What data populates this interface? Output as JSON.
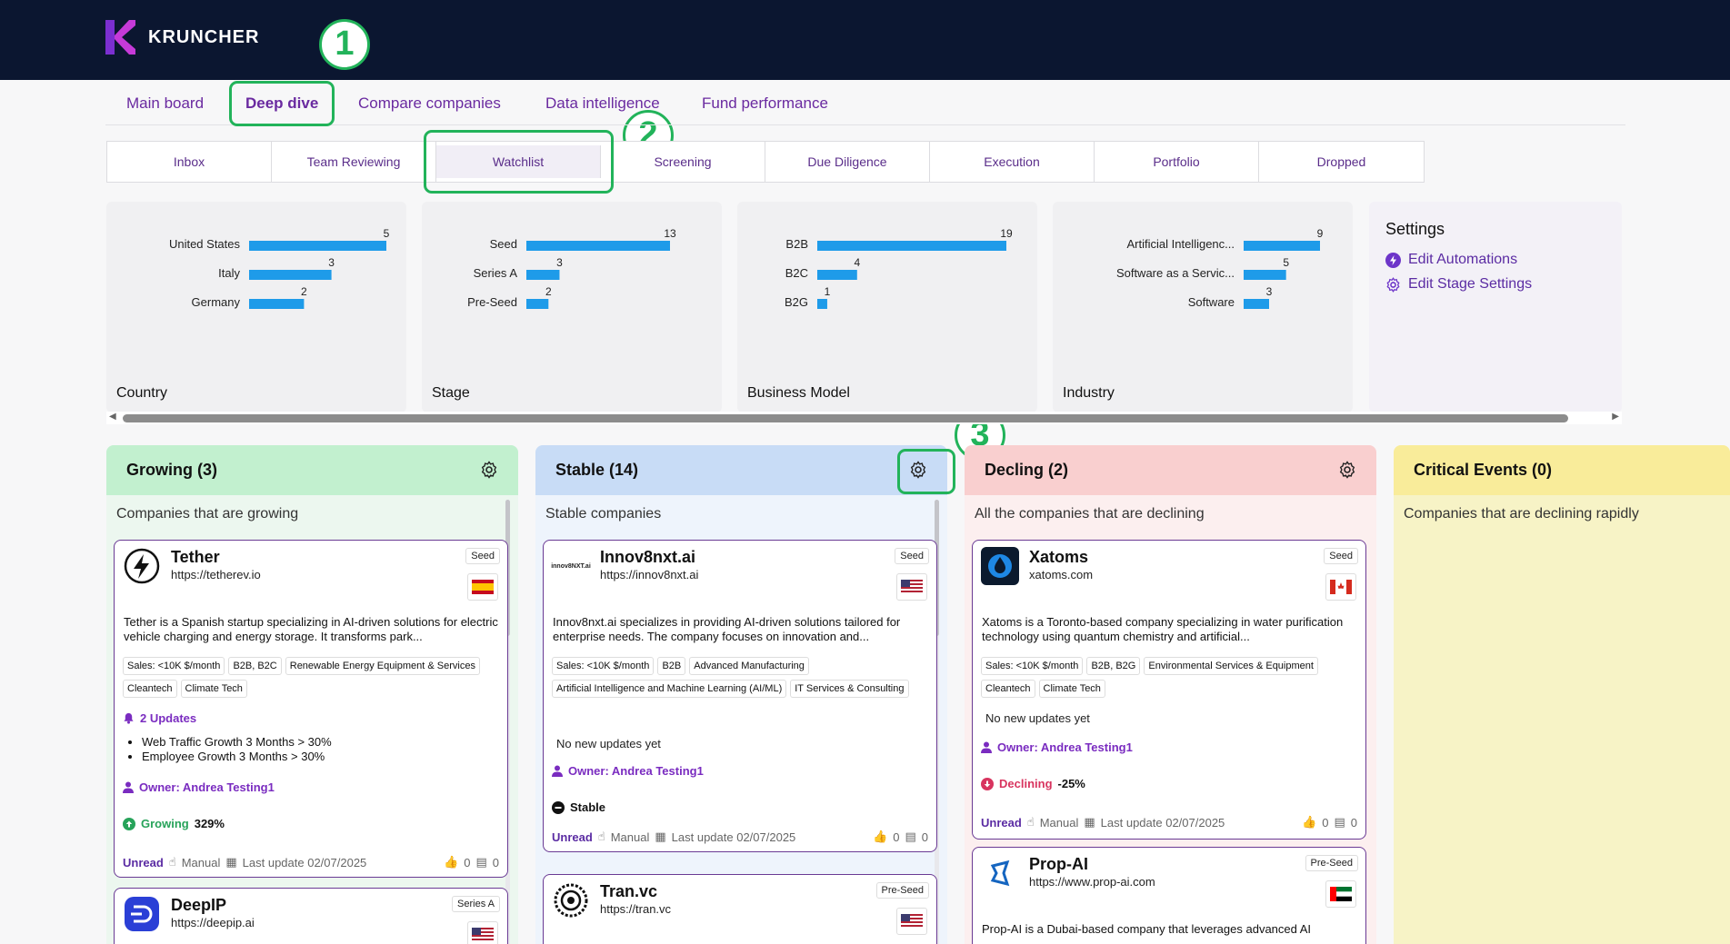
{
  "app": {
    "brand": "KRUNCHER"
  },
  "markers": [
    "1",
    "2",
    "3"
  ],
  "nav": {
    "tabs": [
      {
        "label": "Main board"
      },
      {
        "label": "Deep dive"
      },
      {
        "label": "Compare companies"
      },
      {
        "label": "Data intelligence"
      },
      {
        "label": "Fund performance"
      }
    ],
    "active": "Deep dive"
  },
  "stages": {
    "items": [
      {
        "label": "Inbox"
      },
      {
        "label": "Team Reviewing"
      },
      {
        "label": "Watchlist"
      },
      {
        "label": "Screening"
      },
      {
        "label": "Due Diligence"
      },
      {
        "label": "Execution"
      },
      {
        "label": "Portfolio"
      },
      {
        "label": "Dropped"
      }
    ],
    "active": "Watchlist"
  },
  "chart_data": [
    {
      "type": "bar",
      "orientation": "horizontal",
      "title": "Country",
      "categories": [
        "United States",
        "Italy",
        "Germany"
      ],
      "values": [
        5,
        3,
        2
      ]
    },
    {
      "type": "bar",
      "orientation": "horizontal",
      "title": "Stage",
      "categories": [
        "Seed",
        "Series A",
        "Pre-Seed"
      ],
      "values": [
        13,
        3,
        2
      ]
    },
    {
      "type": "bar",
      "orientation": "horizontal",
      "title": "Business Model",
      "categories": [
        "B2B",
        "B2C",
        "B2G"
      ],
      "values": [
        19,
        4,
        1
      ]
    },
    {
      "type": "bar",
      "orientation": "horizontal",
      "title": "Industry",
      "categories": [
        "Artificial Intelligenc...",
        "Software as a Servic...",
        "Software"
      ],
      "values": [
        9,
        5,
        3
      ]
    }
  ],
  "colors": {
    "bar": "#1e9be9",
    "topbar": "#0b1630",
    "accent": "#5b2ca3",
    "highlight": "#22b35a"
  },
  "settings": {
    "title": "Settings",
    "edit_automations": "Edit Automations",
    "edit_stage_settings": "Edit Stage Settings"
  },
  "columns": {
    "growing": {
      "title": "Growing (3)",
      "description": "Companies that are growing",
      "color": "#c2f0cf",
      "cards": [
        {
          "name": "Tether",
          "url": "https://tetherev.io",
          "stage": "Seed",
          "flag": "Spain",
          "description": "Tether is a Spanish startup specializing in AI-driven solutions for electric vehicle charging and energy storage. It transforms park...",
          "tags": [
            "Sales: <10K $/month",
            "B2B, B2C",
            "Renewable Energy Equipment & Services",
            "Cleantech",
            "Climate Tech"
          ],
          "updates_label": "2 Updates",
          "updates": [
            "Web Traffic Growth 3 Months > 30%",
            "Employee Growth 3 Months > 30%"
          ],
          "owner": "Owner: Andrea Testing1",
          "status_label": "Growing",
          "status_value": "329%",
          "footer": {
            "read": "Unread",
            "mode": "Manual",
            "updated": "Last update 02/07/2025",
            "likes": "0",
            "comments": "0"
          }
        },
        {
          "name": "DeepIP",
          "url": "https://deepip.ai",
          "stage": "Series A",
          "flag": "United States"
        }
      ]
    },
    "stable": {
      "title": "Stable (14)",
      "description": "Stable companies",
      "color": "#c8dcf6",
      "cards": [
        {
          "name": "Innov8nxt.ai",
          "url": "https://innov8nxt.ai",
          "stage": "Seed",
          "flag": "United States",
          "logo_text": "innov8NXT.ai",
          "description": "Innov8nxt.ai specializes in providing AI-driven solutions tailored for enterprise needs. The company focuses on innovation and...",
          "tags": [
            "Sales: <10K $/month",
            "B2B",
            "Advanced Manufacturing",
            "Artificial Intelligence and Machine Learning (AI/ML)",
            "IT Services & Consulting"
          ],
          "no_updates": "No new updates yet",
          "owner": "Owner: Andrea Testing1",
          "status_label": "Stable",
          "footer": {
            "read": "Unread",
            "mode": "Manual",
            "updated": "Last update 02/07/2025",
            "likes": "0",
            "comments": "0"
          }
        },
        {
          "name": "Tran.vc",
          "url": "https://tran.vc",
          "stage": "Pre-Seed",
          "flag": "United States"
        }
      ]
    },
    "declining": {
      "title": "Decling (2)",
      "description": "All the companies that are declining",
      "color": "#f9cfcf",
      "cards": [
        {
          "name": "Xatoms",
          "url": "xatoms.com",
          "stage": "Seed",
          "flag": "Canada",
          "description": "Xatoms is a Toronto-based company specializing in water purification technology using quantum chemistry and artificial...",
          "tags": [
            "Sales: <10K $/month",
            "B2B, B2G",
            "Environmental Services & Equipment",
            "Cleantech",
            "Climate Tech"
          ],
          "no_updates": "No new updates yet",
          "owner": "Owner: Andrea Testing1",
          "status_label": "Declining",
          "status_value": "-25%",
          "footer": {
            "read": "Unread",
            "mode": "Manual",
            "updated": "Last update 02/07/2025",
            "likes": "0",
            "comments": "0"
          }
        },
        {
          "name": "Prop-AI",
          "url": "https://www.prop-ai.com",
          "stage": "Pre-Seed",
          "flag": "United Arab Emirates",
          "description": "Prop-AI is a Dubai-based company that leverages advanced AI"
        }
      ]
    },
    "critical": {
      "title": "Critical Events (0)",
      "description": "Companies that are declining rapidly",
      "color": "#f9ec9a"
    }
  }
}
